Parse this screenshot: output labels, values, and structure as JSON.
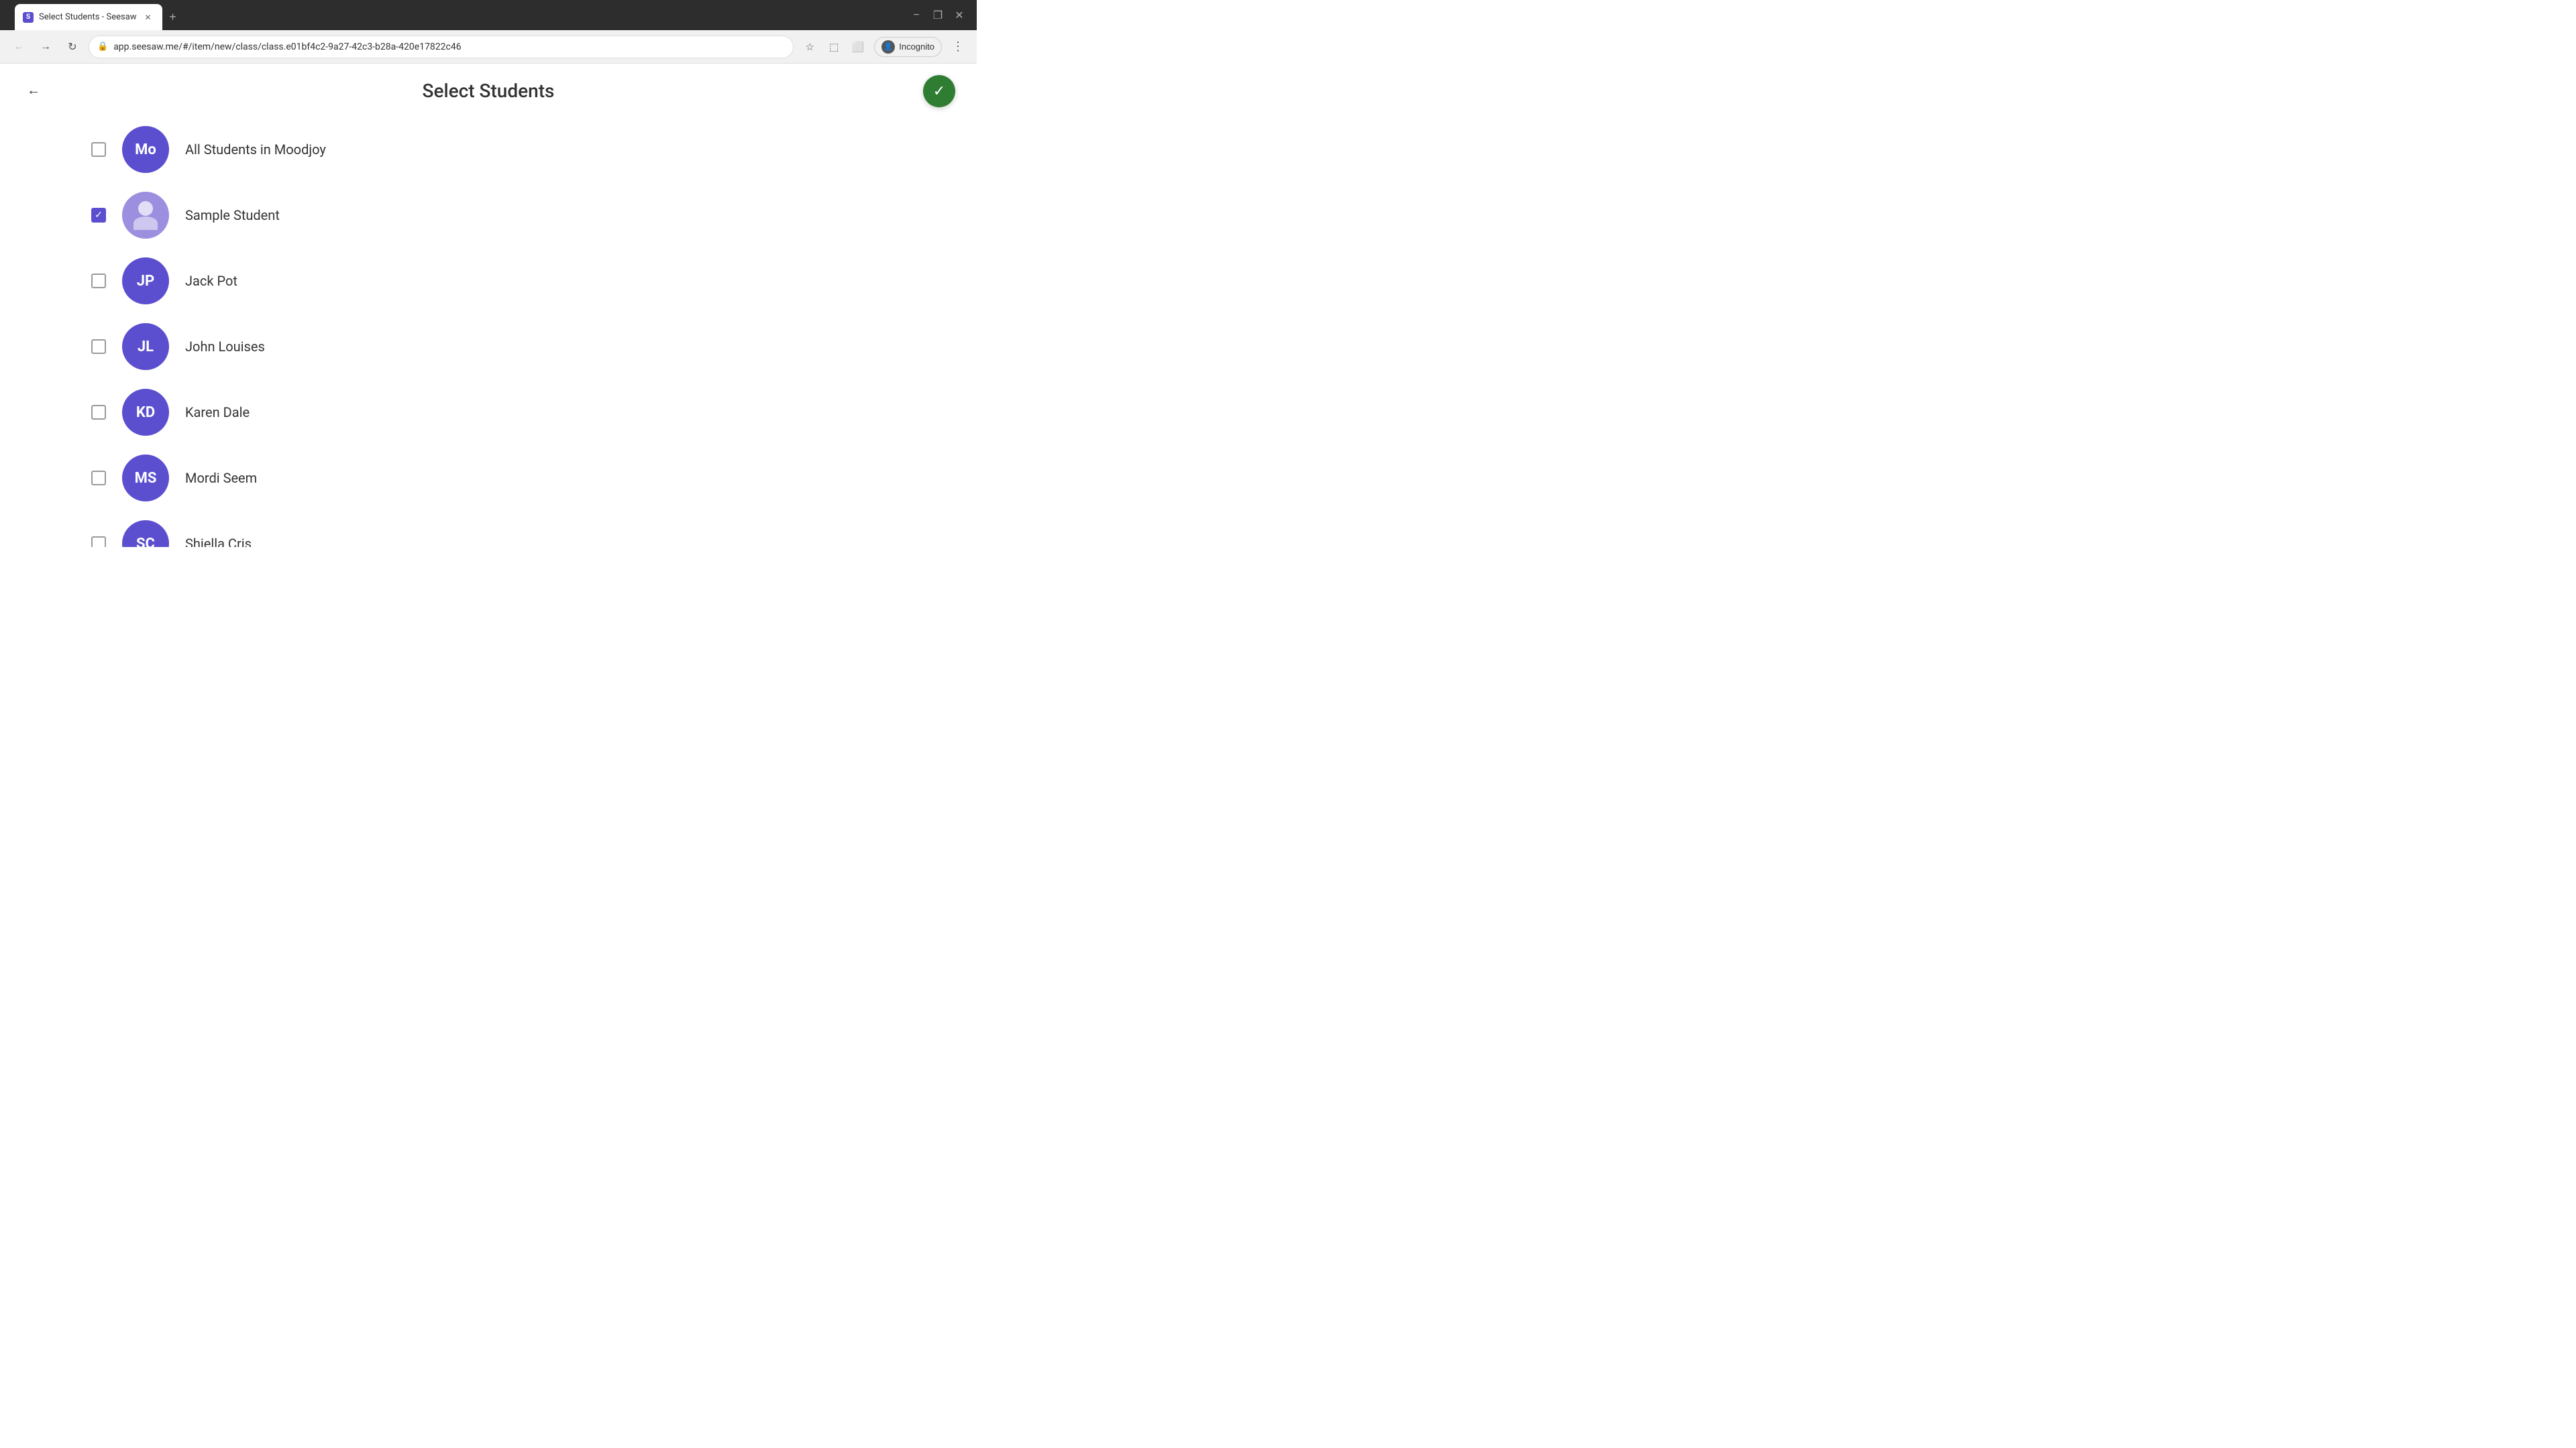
{
  "browser": {
    "tab_favicon": "S",
    "tab_title": "Select Students - Seesaw",
    "url": "app.seesaw.me/#/item/new/class/class.e01bf4c2-9a27-42c3-b28a-420e17822c46",
    "incognito_label": "Incognito",
    "window_minimize": "−",
    "window_restore": "❐",
    "window_close": "✕",
    "tab_close": "✕",
    "tab_new": "+"
  },
  "page": {
    "title": "Select Students",
    "back_icon": "←",
    "confirm_icon": "✓"
  },
  "students": [
    {
      "id": "all",
      "initials": "Mo",
      "name": "All Students in Moodjoy",
      "checked": false,
      "avatar_type": "initials",
      "avatar_color": "#5b4fcf"
    },
    {
      "id": "sample",
      "initials": "",
      "name": "Sample Student",
      "checked": true,
      "avatar_type": "person",
      "avatar_color": "#9c8fdf"
    },
    {
      "id": "jp",
      "initials": "JP",
      "name": "Jack Pot",
      "checked": false,
      "avatar_type": "initials",
      "avatar_color": "#5b4fcf"
    },
    {
      "id": "jl",
      "initials": "JL",
      "name": "John Louises",
      "checked": false,
      "avatar_type": "initials",
      "avatar_color": "#5b4fcf"
    },
    {
      "id": "kd",
      "initials": "KD",
      "name": "Karen Dale",
      "checked": false,
      "avatar_type": "initials",
      "avatar_color": "#5b4fcf"
    },
    {
      "id": "ms",
      "initials": "MS",
      "name": "Mordi Seem",
      "checked": false,
      "avatar_type": "initials",
      "avatar_color": "#5b4fcf"
    },
    {
      "id": "sc",
      "initials": "SC",
      "name": "Shiella Cris",
      "checked": false,
      "avatar_type": "initials",
      "avatar_color": "#5b4fcf"
    }
  ]
}
